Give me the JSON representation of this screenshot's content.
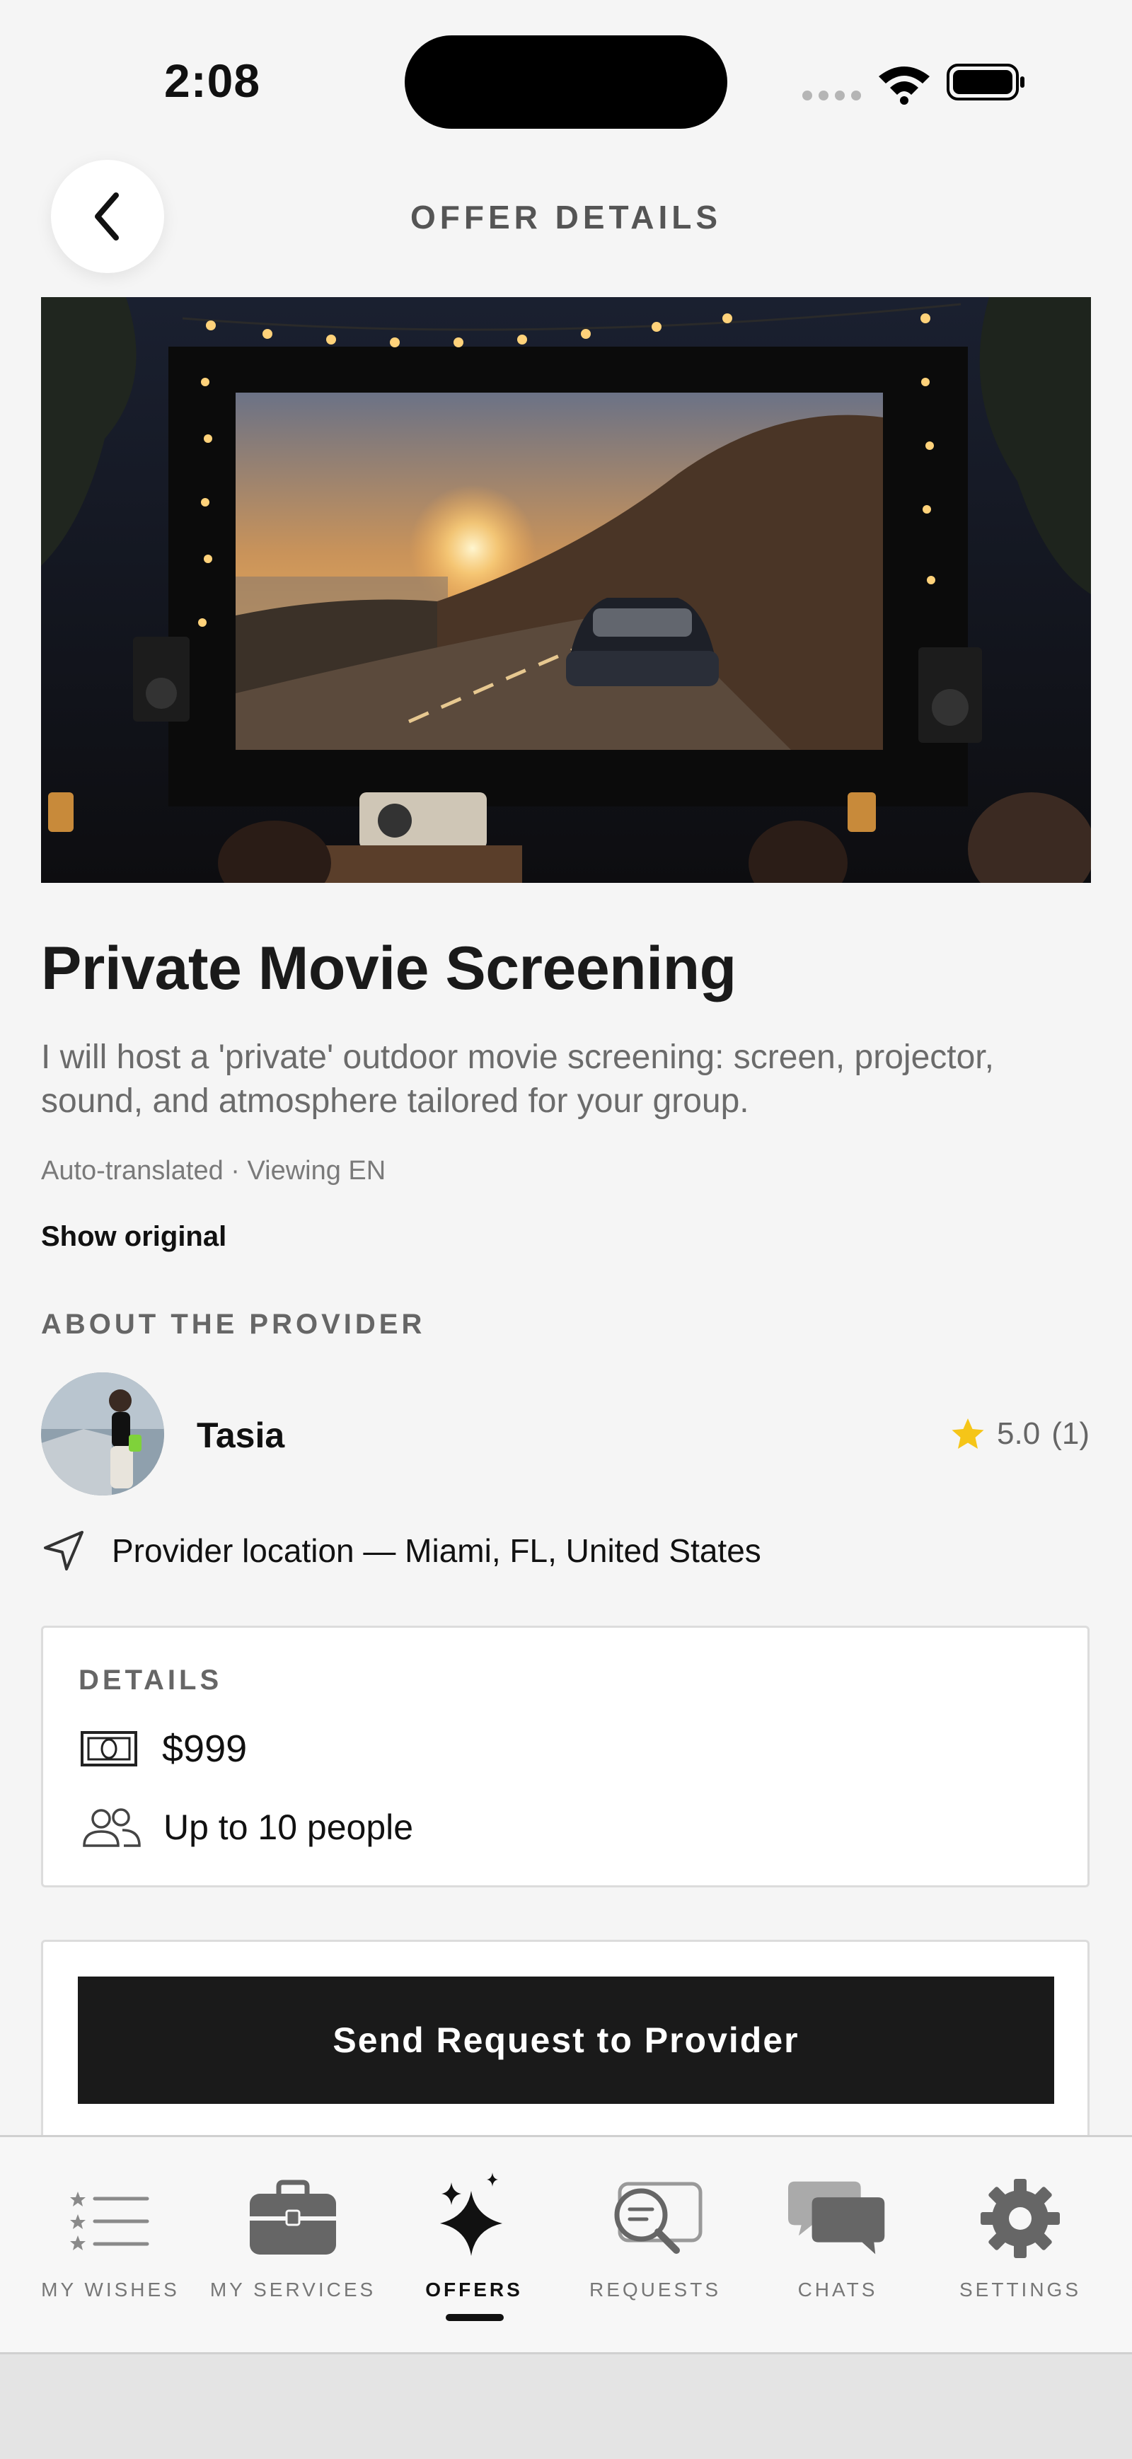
{
  "status_bar": {
    "time": "2:08"
  },
  "header": {
    "title": "OFFER DETAILS",
    "back_icon": "chevron-left-icon"
  },
  "offer": {
    "title": "Private Movie Screening",
    "description": "I will host a 'private' outdoor movie screening: screen, projector, sound, and atmosphere tailored for your group.",
    "translation_note": "Auto-translated · Viewing EN",
    "show_original_label": "Show original"
  },
  "provider": {
    "section_label": "ABOUT THE PROVIDER",
    "name": "Tasia",
    "rating_value": "5.0",
    "rating_count": "(1)",
    "location": "Provider location — Miami, FL, United States",
    "star_color": "#f5c518"
  },
  "details": {
    "label": "DETAILS",
    "price": "$999",
    "capacity": "Up to 10 people"
  },
  "actions": {
    "send_request_label": "Send Request to Provider"
  },
  "tabs": [
    {
      "label": "MY WISHES",
      "icon": "list-stars-icon",
      "active": false
    },
    {
      "label": "MY SERVICES",
      "icon": "briefcase-icon",
      "active": false
    },
    {
      "label": "OFFERS",
      "icon": "sparkles-icon",
      "active": true
    },
    {
      "label": "REQUESTS",
      "icon": "search-request-icon",
      "active": false
    },
    {
      "label": "CHATS",
      "icon": "chat-bubbles-icon",
      "active": false
    },
    {
      "label": "SETTINGS",
      "icon": "gear-icon",
      "active": false
    }
  ]
}
